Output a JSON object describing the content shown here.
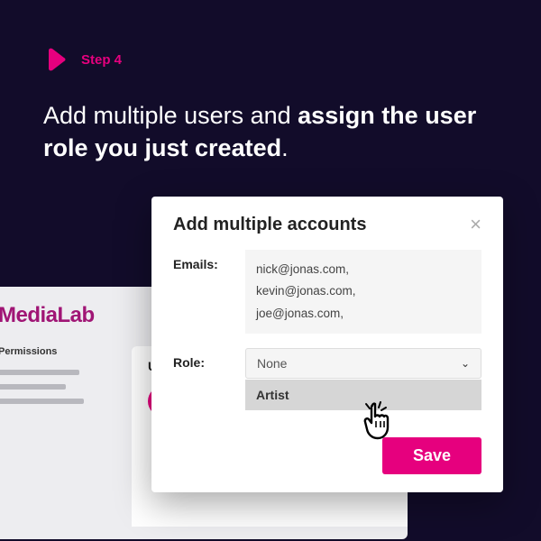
{
  "step": {
    "label": "Step 4"
  },
  "headline": {
    "prefix": "Add multiple users and ",
    "bold": "assign the user role you just created",
    "suffix": "."
  },
  "background": {
    "brand": "MediaLab",
    "permissions_label": "Permissions",
    "users_label": "User"
  },
  "modal": {
    "title": "Add multiple accounts",
    "emails_label": "Emails:",
    "emails_value": "nick@jonas.com,\nkevin@jonas.com,\njoe@jonas.com,",
    "role_label": "Role:",
    "role_selected": "None",
    "role_option": "Artist",
    "save_label": "Save"
  }
}
